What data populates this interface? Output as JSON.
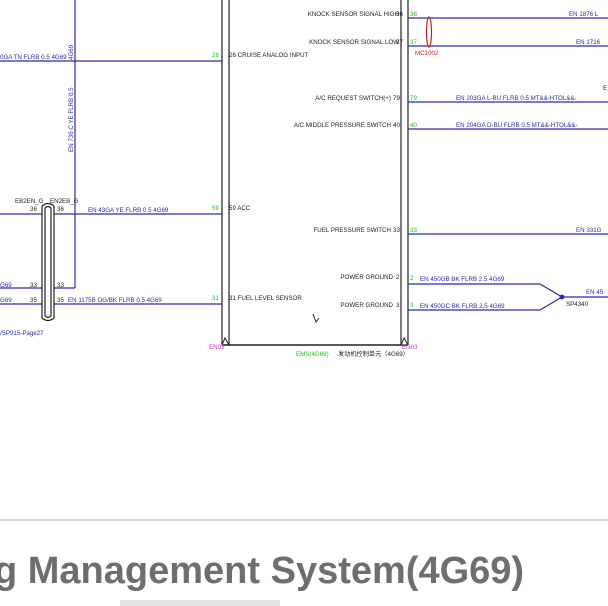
{
  "colors": {
    "wire": "#2a2ab4",
    "pin_number": "#22bb22",
    "shield": "#cc2222",
    "connector_tag": "#cc33cc",
    "frame": "#222222",
    "title": "#6e6e6e"
  },
  "ecu": {
    "right_pins": [
      {
        "label": "KNOCK SENSOR SIGNAL HIGH",
        "pin": "36",
        "wire_pin": "36",
        "wire": "EN 1876 L"
      },
      {
        "label": "KNOCK SENSOR SIGNAL LOW",
        "pin": "37",
        "wire_pin": "37",
        "wire": "EN 1716"
      },
      {
        "label": "A/C REQUEST SWITCH(+)",
        "pin": "79",
        "wire_pin": "79",
        "wire": "EN 203GA L-BU FLRB 0.5 MT&&-HTOL&&-"
      },
      {
        "label": "A/C MIDDLE PRESSURE SWITCH",
        "pin": "40",
        "wire_pin": "40",
        "wire": "EN 204GA D-BU FLRB 0.5 MT&&-HTOL&&-"
      },
      {
        "label": "FUEL PRESSURE SWITCH",
        "pin": "33",
        "wire_pin": "33",
        "wire": "EN 331G"
      },
      {
        "label": "POWER GROUND",
        "pin": "2",
        "wire_pin": "2",
        "wire": "EN 450GB BK FLRB 2.5 4G69"
      },
      {
        "label": "POWER GROUND",
        "pin": "3",
        "wire_pin": "3",
        "wire": "EN 450GC BK FLRB 2.5 4G69"
      }
    ],
    "left_pins": [
      {
        "label": "26 CRUISE ANALOG INPUT",
        "wire_pin": "26"
      },
      {
        "label": "59 ACC",
        "wire_pin": "59"
      },
      {
        "label": "31 FUEL LEVEL SENSOR",
        "wire_pin": "31"
      }
    ],
    "connector_left": "EN03",
    "connector_right": "EN03",
    "module_code": "EMS(4G69)",
    "module_name": "发动机控制单元（4G69）"
  },
  "shield_tag": "MC1002",
  "splice": {
    "name": "SP4340",
    "wire": "EN 45"
  },
  "left_wires": {
    "top": "0GA TN FLRB 0.5 4G69",
    "vertical_1": "EN 736 C YE FLRB 0.5",
    "vertical_2": "4G69",
    "acc_wire": "EN 43GA YE FLRB 0.5 4G69",
    "fuel_wire": "EN 1175B OG/BK FLRB 0.5 4G69",
    "stub_1": "G69",
    "stub_2": "G69"
  },
  "connectors": {
    "eb2en": "EB2EN_G",
    "en2eb": "EN2EB_G",
    "eb2en_pin": "36",
    "en2eb_pin": "36",
    "row33_a": "33",
    "row33_b": "33",
    "row35_a": "35",
    "row35_b": "35"
  },
  "page_ref": "/SP915-Page27",
  "edge_letter": "E",
  "title": "g Management System(4G69)"
}
